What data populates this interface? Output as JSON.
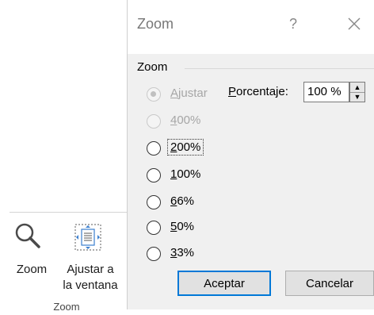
{
  "ribbon": {
    "zoom_label": "Zoom",
    "fit_label_line1": "Ajustar a",
    "fit_label_line2": "la ventana",
    "group_label": "Zoom",
    "icons": [
      "magnifier-icon",
      "fit-to-window-icon"
    ]
  },
  "dialog": {
    "title": "Zoom",
    "help": "?",
    "close_icon": "close-icon",
    "group_label": "Zoom",
    "options": [
      {
        "access": "A",
        "rest": "justar",
        "selected": true,
        "enabled": false
      },
      {
        "access": "4",
        "rest": "00%",
        "selected": false,
        "enabled": false
      },
      {
        "access": "2",
        "rest": "00%",
        "selected": false,
        "enabled": true,
        "focused": true
      },
      {
        "access": "1",
        "rest": "00%",
        "selected": false,
        "enabled": true
      },
      {
        "access": "6",
        "rest": "6%",
        "selected": false,
        "enabled": true
      },
      {
        "access": "5",
        "rest": "0%",
        "selected": false,
        "enabled": true
      },
      {
        "access": "3",
        "rest": "3%",
        "selected": false,
        "enabled": true
      }
    ],
    "percentage": {
      "label_access": "P",
      "label_rest": "orcentaje:",
      "value": "100 %"
    },
    "buttons": {
      "ok": "Aceptar",
      "cancel": "Cancelar"
    },
    "accent_color": "#0078d7"
  }
}
